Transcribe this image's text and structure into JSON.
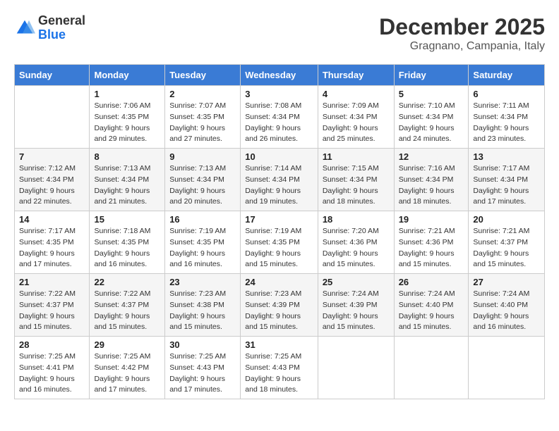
{
  "logo": {
    "general": "General",
    "blue": "Blue"
  },
  "title": "December 2025",
  "location": "Gragnano, Campania, Italy",
  "days_of_week": [
    "Sunday",
    "Monday",
    "Tuesday",
    "Wednesday",
    "Thursday",
    "Friday",
    "Saturday"
  ],
  "weeks": [
    [
      {
        "day": "",
        "sunrise": "",
        "sunset": "",
        "daylight": ""
      },
      {
        "day": "1",
        "sunrise": "Sunrise: 7:06 AM",
        "sunset": "Sunset: 4:35 PM",
        "daylight": "Daylight: 9 hours and 29 minutes."
      },
      {
        "day": "2",
        "sunrise": "Sunrise: 7:07 AM",
        "sunset": "Sunset: 4:35 PM",
        "daylight": "Daylight: 9 hours and 27 minutes."
      },
      {
        "day": "3",
        "sunrise": "Sunrise: 7:08 AM",
        "sunset": "Sunset: 4:34 PM",
        "daylight": "Daylight: 9 hours and 26 minutes."
      },
      {
        "day": "4",
        "sunrise": "Sunrise: 7:09 AM",
        "sunset": "Sunset: 4:34 PM",
        "daylight": "Daylight: 9 hours and 25 minutes."
      },
      {
        "day": "5",
        "sunrise": "Sunrise: 7:10 AM",
        "sunset": "Sunset: 4:34 PM",
        "daylight": "Daylight: 9 hours and 24 minutes."
      },
      {
        "day": "6",
        "sunrise": "Sunrise: 7:11 AM",
        "sunset": "Sunset: 4:34 PM",
        "daylight": "Daylight: 9 hours and 23 minutes."
      }
    ],
    [
      {
        "day": "7",
        "sunrise": "Sunrise: 7:12 AM",
        "sunset": "Sunset: 4:34 PM",
        "daylight": "Daylight: 9 hours and 22 minutes."
      },
      {
        "day": "8",
        "sunrise": "Sunrise: 7:13 AM",
        "sunset": "Sunset: 4:34 PM",
        "daylight": "Daylight: 9 hours and 21 minutes."
      },
      {
        "day": "9",
        "sunrise": "Sunrise: 7:13 AM",
        "sunset": "Sunset: 4:34 PM",
        "daylight": "Daylight: 9 hours and 20 minutes."
      },
      {
        "day": "10",
        "sunrise": "Sunrise: 7:14 AM",
        "sunset": "Sunset: 4:34 PM",
        "daylight": "Daylight: 9 hours and 19 minutes."
      },
      {
        "day": "11",
        "sunrise": "Sunrise: 7:15 AM",
        "sunset": "Sunset: 4:34 PM",
        "daylight": "Daylight: 9 hours and 18 minutes."
      },
      {
        "day": "12",
        "sunrise": "Sunrise: 7:16 AM",
        "sunset": "Sunset: 4:34 PM",
        "daylight": "Daylight: 9 hours and 18 minutes."
      },
      {
        "day": "13",
        "sunrise": "Sunrise: 7:17 AM",
        "sunset": "Sunset: 4:34 PM",
        "daylight": "Daylight: 9 hours and 17 minutes."
      }
    ],
    [
      {
        "day": "14",
        "sunrise": "Sunrise: 7:17 AM",
        "sunset": "Sunset: 4:35 PM",
        "daylight": "Daylight: 9 hours and 17 minutes."
      },
      {
        "day": "15",
        "sunrise": "Sunrise: 7:18 AM",
        "sunset": "Sunset: 4:35 PM",
        "daylight": "Daylight: 9 hours and 16 minutes."
      },
      {
        "day": "16",
        "sunrise": "Sunrise: 7:19 AM",
        "sunset": "Sunset: 4:35 PM",
        "daylight": "Daylight: 9 hours and 16 minutes."
      },
      {
        "day": "17",
        "sunrise": "Sunrise: 7:19 AM",
        "sunset": "Sunset: 4:35 PM",
        "daylight": "Daylight: 9 hours and 15 minutes."
      },
      {
        "day": "18",
        "sunrise": "Sunrise: 7:20 AM",
        "sunset": "Sunset: 4:36 PM",
        "daylight": "Daylight: 9 hours and 15 minutes."
      },
      {
        "day": "19",
        "sunrise": "Sunrise: 7:21 AM",
        "sunset": "Sunset: 4:36 PM",
        "daylight": "Daylight: 9 hours and 15 minutes."
      },
      {
        "day": "20",
        "sunrise": "Sunrise: 7:21 AM",
        "sunset": "Sunset: 4:37 PM",
        "daylight": "Daylight: 9 hours and 15 minutes."
      }
    ],
    [
      {
        "day": "21",
        "sunrise": "Sunrise: 7:22 AM",
        "sunset": "Sunset: 4:37 PM",
        "daylight": "Daylight: 9 hours and 15 minutes."
      },
      {
        "day": "22",
        "sunrise": "Sunrise: 7:22 AM",
        "sunset": "Sunset: 4:37 PM",
        "daylight": "Daylight: 9 hours and 15 minutes."
      },
      {
        "day": "23",
        "sunrise": "Sunrise: 7:23 AM",
        "sunset": "Sunset: 4:38 PM",
        "daylight": "Daylight: 9 hours and 15 minutes."
      },
      {
        "day": "24",
        "sunrise": "Sunrise: 7:23 AM",
        "sunset": "Sunset: 4:39 PM",
        "daylight": "Daylight: 9 hours and 15 minutes."
      },
      {
        "day": "25",
        "sunrise": "Sunrise: 7:24 AM",
        "sunset": "Sunset: 4:39 PM",
        "daylight": "Daylight: 9 hours and 15 minutes."
      },
      {
        "day": "26",
        "sunrise": "Sunrise: 7:24 AM",
        "sunset": "Sunset: 4:40 PM",
        "daylight": "Daylight: 9 hours and 15 minutes."
      },
      {
        "day": "27",
        "sunrise": "Sunrise: 7:24 AM",
        "sunset": "Sunset: 4:40 PM",
        "daylight": "Daylight: 9 hours and 16 minutes."
      }
    ],
    [
      {
        "day": "28",
        "sunrise": "Sunrise: 7:25 AM",
        "sunset": "Sunset: 4:41 PM",
        "daylight": "Daylight: 9 hours and 16 minutes."
      },
      {
        "day": "29",
        "sunrise": "Sunrise: 7:25 AM",
        "sunset": "Sunset: 4:42 PM",
        "daylight": "Daylight: 9 hours and 17 minutes."
      },
      {
        "day": "30",
        "sunrise": "Sunrise: 7:25 AM",
        "sunset": "Sunset: 4:43 PM",
        "daylight": "Daylight: 9 hours and 17 minutes."
      },
      {
        "day": "31",
        "sunrise": "Sunrise: 7:25 AM",
        "sunset": "Sunset: 4:43 PM",
        "daylight": "Daylight: 9 hours and 18 minutes."
      },
      {
        "day": "",
        "sunrise": "",
        "sunset": "",
        "daylight": ""
      },
      {
        "day": "",
        "sunrise": "",
        "sunset": "",
        "daylight": ""
      },
      {
        "day": "",
        "sunrise": "",
        "sunset": "",
        "daylight": ""
      }
    ]
  ]
}
